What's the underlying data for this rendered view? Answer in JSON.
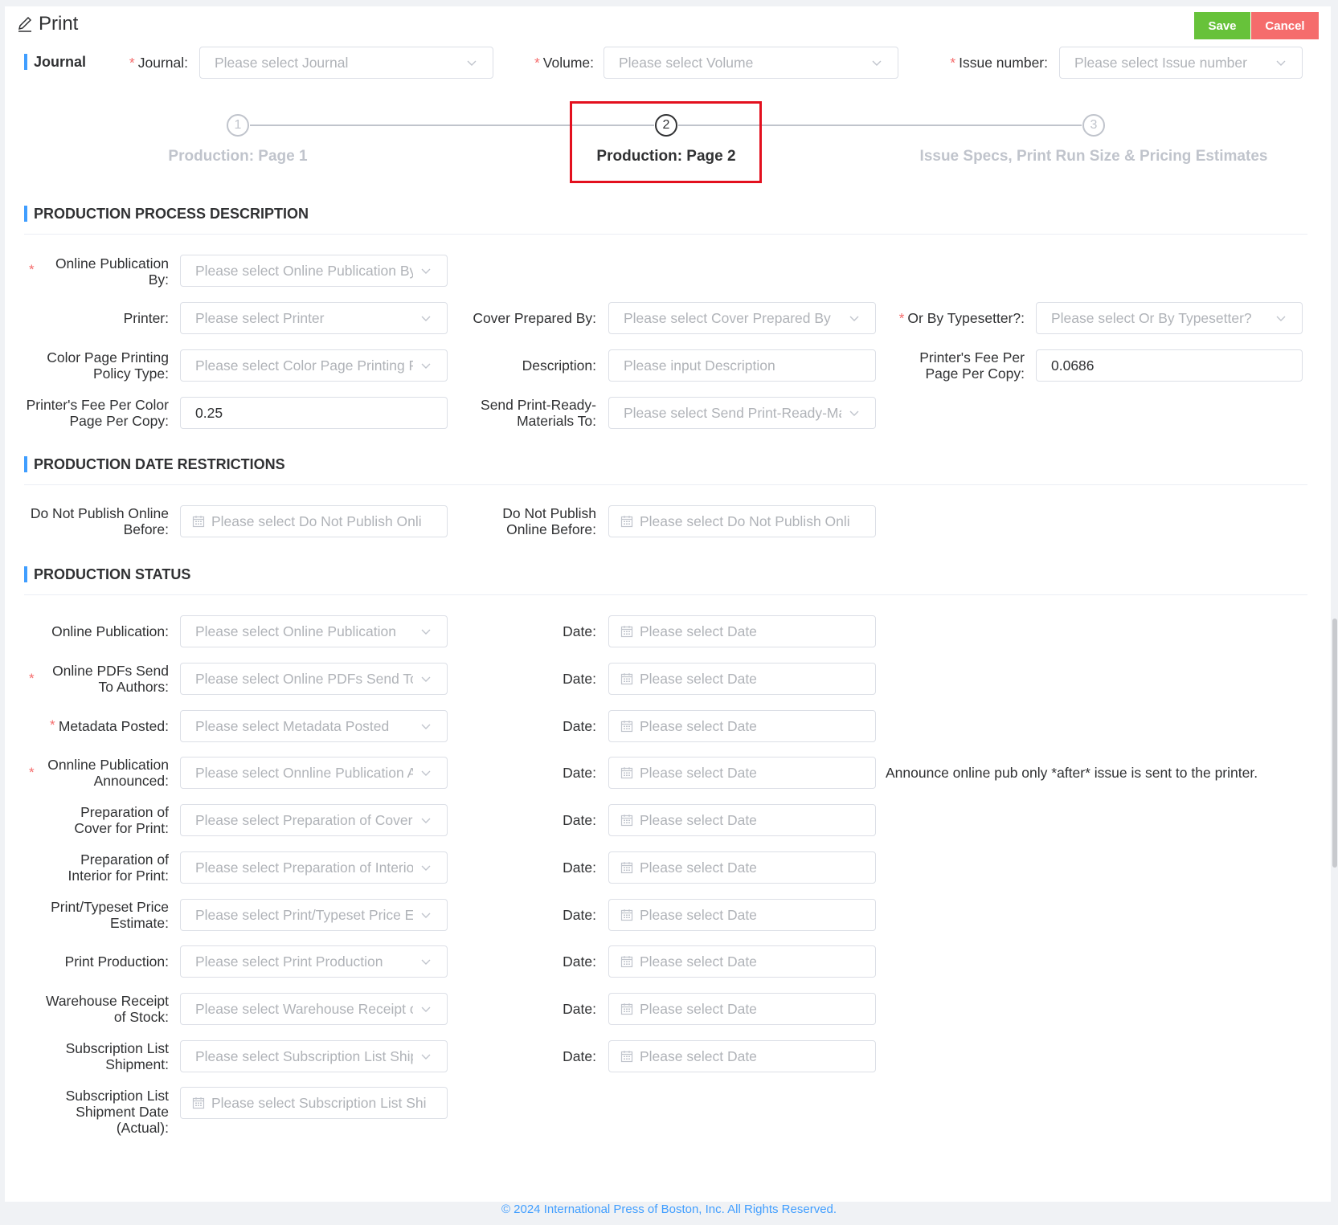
{
  "header": {
    "title": "Print",
    "save_label": "Save",
    "cancel_label": "Cancel",
    "journal_tag": "Journal"
  },
  "filters": {
    "journal": {
      "label": "Journal:",
      "placeholder": "Please select Journal"
    },
    "volume": {
      "label": "Volume:",
      "placeholder": "Please select Volume"
    },
    "issue": {
      "label": "Issue number:",
      "placeholder": "Please select Issue number"
    }
  },
  "steps": [
    {
      "number": "1",
      "title": "Production: Page 1"
    },
    {
      "number": "2",
      "title": "Production: Page 2"
    },
    {
      "number": "3",
      "title": "Issue Specs, Print Run Size & Pricing Estimates"
    }
  ],
  "process": {
    "title": "PRODUCTION PROCESS DESCRIPTION",
    "online_pub_by": {
      "label": "Online Publication By:",
      "placeholder": "Please select Online Publication By"
    },
    "printer": {
      "label": "Printer:",
      "placeholder": "Please select Printer"
    },
    "cover_prepared_by": {
      "label": "Cover Prepared By:",
      "placeholder": "Please select Cover Prepared By"
    },
    "or_by_typesetter": {
      "label": "Or By Typesetter?:",
      "placeholder": "Please select Or By Typesetter?"
    },
    "color_policy": {
      "label": "Color Page Printing Policy Type:",
      "placeholder": "Please select Color Page Printing Po"
    },
    "description": {
      "label": "Description:",
      "placeholder": "Please input Description"
    },
    "fee_per_page": {
      "label": "Printer's Fee Per Page Per Copy:",
      "value": "0.0686"
    },
    "fee_per_color": {
      "label": "Printer's Fee Per Color Page Per Copy:",
      "value": "0.25"
    },
    "send_materials": {
      "label": "Send Print-Ready-Materials To:",
      "placeholder": "Please select Send Print-Ready-Mat"
    }
  },
  "date_restrictions": {
    "title": "PRODUCTION DATE RESTRICTIONS",
    "fields": [
      {
        "label": "Do Not Publish Online Before:",
        "placeholder": "Please select Do Not Publish Onli"
      },
      {
        "label": "Do Not Publish Online Before:",
        "placeholder": "Please select Do Not Publish Onli"
      }
    ]
  },
  "status": {
    "title": "PRODUCTION STATUS",
    "date_label": "Date:",
    "date_placeholder": "Please select Date",
    "rows": [
      {
        "label": "Online Publication:",
        "placeholder": "Please select Online Publication",
        "required": false
      },
      {
        "label": "Online PDFs Send To Authors:",
        "placeholder": "Please select Online PDFs Send To A",
        "required": true
      },
      {
        "label": "Metadata Posted:",
        "placeholder": "Please select Metadata Posted",
        "required": true
      },
      {
        "label": "Onnline Publication Announced:",
        "placeholder": "Please select Onnline Publication An",
        "required": true
      },
      {
        "label": "Preparation of Cover for Print:",
        "placeholder": "Please select Preparation of Cover fo",
        "required": false
      },
      {
        "label": "Preparation of Interior for Print:",
        "placeholder": "Please select Preparation of Interior",
        "required": false
      },
      {
        "label": "Print/Typeset Price Estimate:",
        "placeholder": "Please select Print/Typeset Price Est",
        "required": false
      },
      {
        "label": "Print Production:",
        "placeholder": "Please select Print Production",
        "required": false
      },
      {
        "label": "Warehouse Receipt of Stock:",
        "placeholder": "Please select Warehouse Receipt of",
        "required": false
      },
      {
        "label": "Subscription List Shipment:",
        "placeholder": "Please select Subscription List Shipm",
        "required": false
      }
    ],
    "announce_note": "Announce online pub only *after* issue is sent to the printer.",
    "shipment_actual": {
      "label": "Subscription List Shipment Date (Actual):",
      "placeholder": "Please select Subscription List Shi"
    }
  },
  "footer": "© 2024 International Press of Boston, Inc. All Rights Reserved."
}
